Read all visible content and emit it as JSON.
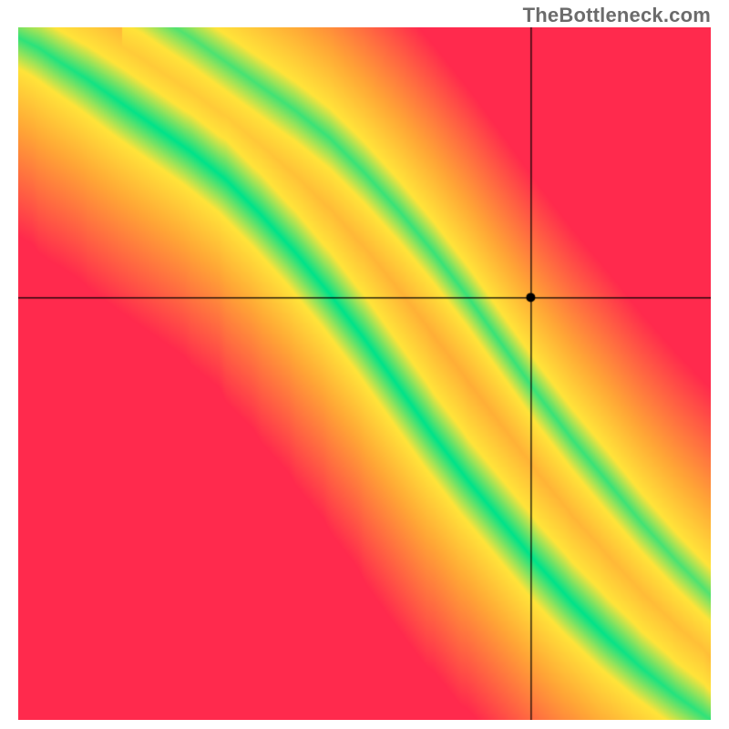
{
  "watermark": "TheBottleneck.com",
  "chart_data": {
    "type": "heatmap",
    "title": "",
    "xlabel": "",
    "ylabel": "",
    "xlim": [
      0,
      1
    ],
    "ylim": [
      0,
      1
    ],
    "colors": {
      "good": "#00e28a",
      "mid": "#ffe43a",
      "warn": "#ffa836",
      "bad": "#ff2a4d"
    },
    "crosshair": {
      "x": 0.74,
      "y": 0.61
    },
    "marker": {
      "x": 0.74,
      "y": 0.61,
      "radius": 5
    },
    "optimal_curve": [
      {
        "x": 0.0,
        "y": 0.985
      },
      {
        "x": 0.03,
        "y": 0.97
      },
      {
        "x": 0.06,
        "y": 0.95
      },
      {
        "x": 0.1,
        "y": 0.925
      },
      {
        "x": 0.15,
        "y": 0.89
      },
      {
        "x": 0.2,
        "y": 0.855
      },
      {
        "x": 0.25,
        "y": 0.82
      },
      {
        "x": 0.3,
        "y": 0.78
      },
      {
        "x": 0.35,
        "y": 0.73
      },
      {
        "x": 0.4,
        "y": 0.675
      },
      {
        "x": 0.45,
        "y": 0.615
      },
      {
        "x": 0.5,
        "y": 0.55
      },
      {
        "x": 0.55,
        "y": 0.48
      },
      {
        "x": 0.6,
        "y": 0.41
      },
      {
        "x": 0.65,
        "y": 0.345
      },
      {
        "x": 0.7,
        "y": 0.285
      },
      {
        "x": 0.75,
        "y": 0.225
      },
      {
        "x": 0.8,
        "y": 0.17
      },
      {
        "x": 0.85,
        "y": 0.12
      },
      {
        "x": 0.9,
        "y": 0.075
      },
      {
        "x": 0.95,
        "y": 0.035
      },
      {
        "x": 1.0,
        "y": 0.0
      }
    ],
    "band_half_width": 0.045,
    "secondary_curve_offset": {
      "dx": 0.15,
      "dy": 0.06
    },
    "notes": "Heatmap color encodes deviation from an optimal CPU/GPU pairing curve. Green = balanced, yellow = mild mismatch, orange/red = bottleneck. Crosshair shows selected configuration; y-axis goes upward (0 at bottom, 1 at top). Curve points store y in data-space (0 bottom, 1 top)."
  }
}
